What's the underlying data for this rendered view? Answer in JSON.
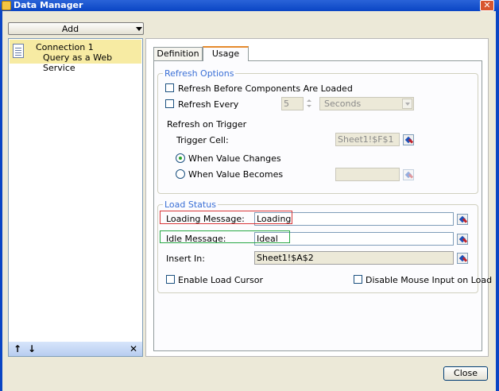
{
  "window": {
    "title": "Data Manager",
    "close_symbol": "✕"
  },
  "left": {
    "add_label": "Add",
    "connection": {
      "name": "Connection 1",
      "type": "Query as a Web Service"
    },
    "toolbar": {
      "up": "↑",
      "down": "↓",
      "remove": "✕"
    }
  },
  "tabs": {
    "definition": "Definition",
    "usage": "Usage",
    "active": "Usage"
  },
  "refresh": {
    "legend": "Refresh Options",
    "before_load_label": "Refresh Before Components Are Loaded",
    "every_label": "Refresh Every",
    "every_value": "5",
    "unit_value": "Seconds",
    "on_trigger_label": "Refresh on Trigger",
    "trigger_cell_label": "Trigger Cell:",
    "trigger_cell_value": "Sheet1!$F$1",
    "when_changes_label": "When Value Changes",
    "when_becomes_label": "When Value Becomes",
    "when_becomes_value": ""
  },
  "load": {
    "legend": "Load Status",
    "loading_label": "Loading Message:",
    "loading_value": "Loading",
    "idle_label": "Idle Message:",
    "idle_value": "Ideal",
    "insert_label": "Insert In:",
    "insert_value": "Sheet1!$A$2",
    "cursor_label": "Enable Load Cursor",
    "disable_mouse_label": "Disable Mouse Input on Load"
  },
  "footer": {
    "close_label": "Close"
  },
  "colors": {
    "title_bar": "#0a45c4",
    "selected_item": "#f7eba3",
    "legend_text": "#3a6fd6",
    "active_tab_accent": "#e68b2c",
    "highlight_red": "#d9383a",
    "highlight_green": "#27a844"
  }
}
